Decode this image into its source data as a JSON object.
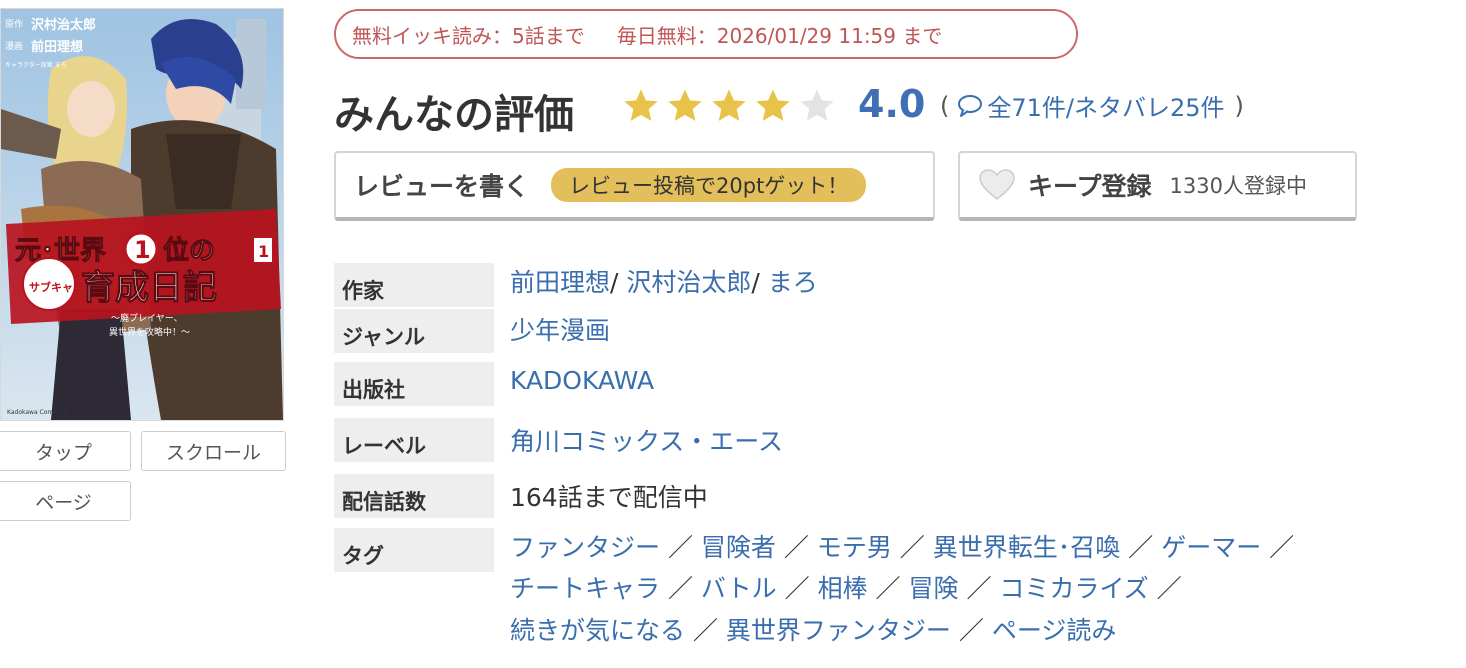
{
  "viewer_buttons": {
    "tap": "タップ",
    "scroll": "スクロール",
    "page": "ページ"
  },
  "campaign": {
    "free_binge": "無料イッキ読み：5話まで",
    "daily_free": "毎日無料：2026/01/29 11:59 まで"
  },
  "rating": {
    "title": "みんなの評価",
    "stars": 4,
    "max_stars": 5,
    "score": "4.0",
    "open_paren": "(",
    "close_paren": ")",
    "review_count_text": "全71件/ネタバレ25件"
  },
  "actions": {
    "review_label": "レビューを書く",
    "review_promo": "レビュー投稿で20ptゲット！",
    "keep_label": "キープ登録",
    "keep_count": "1330人登録中"
  },
  "info": {
    "author_label": "作家",
    "authors": [
      "前田理想",
      "沢村治太郎",
      "まろ"
    ],
    "genre_label": "ジャンル",
    "genre": "少年漫画",
    "publisher_label": "出版社",
    "publisher": "KADOKAWA",
    "imprint_label": "レーベル",
    "imprint": "角川コミックス・エース",
    "episodes_label": "配信話数",
    "episodes": "164話まで配信中",
    "tags_label": "タグ",
    "tags": [
      "ファンタジー",
      "冒険者",
      "モテ男",
      "異世界転生･召喚",
      "ゲーマー",
      "チートキャラ",
      "バトル",
      "相棒",
      "冒険",
      "コミカライズ",
      "続きが気になる",
      "異世界ファンタジー",
      "ページ読み"
    ]
  },
  "cover": {
    "title_line1": "元･世界",
    "volume_badge": "1",
    "title_line1b": "位の",
    "sub_vertical": "サブキャラ",
    "title_line2": "育成日記",
    "tagline1": "〜廃プレイヤー、",
    "tagline2": "異世界を攻略中！〜",
    "credit1_label": "原作",
    "credit1_name": "沢村治太郎",
    "credit2_label": "漫画",
    "credit2_name": "前田理想",
    "credit3": "キャラクター原案 まろ",
    "spine_volume": "1",
    "publisher_mark": "Kadokawa Comics A"
  },
  "colors": {
    "link": "#3a6eae",
    "score": "#3f6fb5",
    "star_filled": "#e9c24a",
    "star_empty": "#e3e3e3",
    "campaign_border": "#c96a6a",
    "promo_bg": "#e3bf5b",
    "label_bg": "#eeeeee"
  },
  "icons": {
    "review_bubble": "speech-bubble-icon",
    "keep": "heart-icon",
    "rating": "star-icon"
  }
}
